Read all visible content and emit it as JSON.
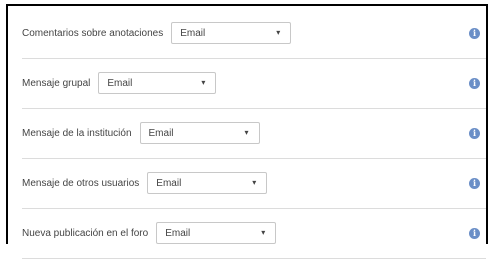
{
  "rows": [
    {
      "label": "Comentarios sobre anotaciones",
      "select_value": "Email",
      "caret": "▾",
      "icon": "info-icon",
      "icon_glyph": "i"
    },
    {
      "label": "Mensaje grupal",
      "select_value": "Email",
      "caret": "▾",
      "icon": "info-icon",
      "icon_glyph": "i"
    },
    {
      "label": "Mensaje de la institución",
      "select_value": "Email",
      "caret": "▾",
      "icon": "info-icon",
      "icon_glyph": "i"
    },
    {
      "label": "Mensaje de otros usuarios",
      "select_value": "Email",
      "caret": "▾",
      "icon": "info-icon",
      "icon_glyph": "i"
    },
    {
      "label": "Nueva publicación en el foro",
      "select_value": "Email",
      "caret": "▾",
      "icon": "info-icon",
      "icon_glyph": "i"
    }
  ],
  "colors": {
    "info_icon": "#6b8fc7",
    "border": "#dcdcdc",
    "text": "#444444"
  }
}
